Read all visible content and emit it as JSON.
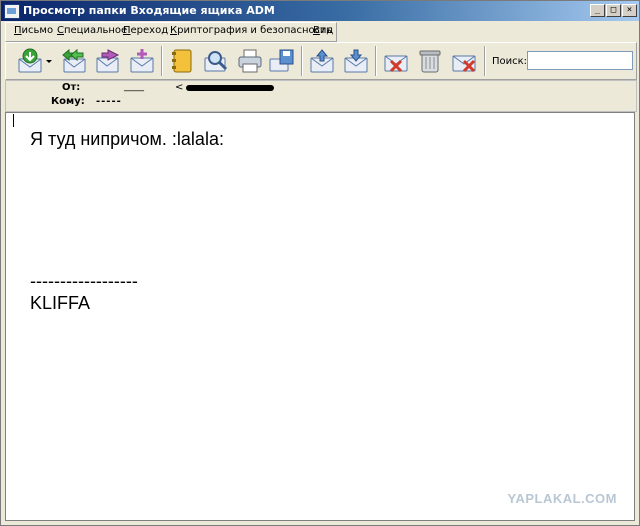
{
  "window": {
    "title": "Просмотр папки Входящие ящика ADM",
    "minimize_glyph": "_",
    "maximize_glyph": "□",
    "close_glyph": "×"
  },
  "menu": {
    "items": [
      {
        "label": "Письмо",
        "underline": "П",
        "rest": "исьмо"
      },
      {
        "label": "Специальное",
        "underline": "С",
        "rest": "пециальное"
      },
      {
        "label": "Переход",
        "underline": "П",
        "rest": "ереход"
      },
      {
        "label": "Криптография и безопасность",
        "underline": "К",
        "rest": "риптография и безопасность"
      },
      {
        "label": "Вид",
        "underline": "В",
        "rest": "ид"
      }
    ]
  },
  "toolbar": {
    "icons": [
      "get-mail-icon",
      "dropdown-arrow-icon",
      "reply-all-icon",
      "forward-icon",
      "new-message-icon",
      "address-book-icon",
      "find-icon",
      "print-icon",
      "save-icon",
      "prev-message-icon",
      "next-message-icon",
      "mark-junk-icon",
      "trash-icon",
      "delete-icon"
    ],
    "search_label": "Поиск:",
    "search_value": ""
  },
  "header": {
    "from_label": "От:",
    "from_value": "____",
    "from_address_prefix": "<",
    "to_label": "Кому:",
    "to_value": "-----"
  },
  "message": {
    "line1": "Я туд нипричом. :lalala:",
    "signature_sep": "------------------",
    "signature": "KLIFFA"
  },
  "watermark": "YAPLAKAL.COM",
  "colors": {
    "title_gradient_start": "#0a246a",
    "title_gradient_end": "#a6caf0",
    "chrome": "#ece9d8",
    "icon_green": "#3aa33a",
    "icon_blue": "#5a8fd0",
    "icon_red": "#d23a2a"
  }
}
